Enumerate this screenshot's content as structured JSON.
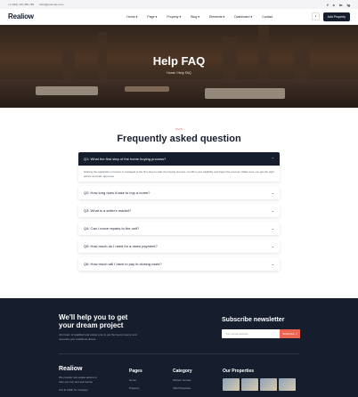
{
  "topbar": {
    "phone": "+1 (904) 123-456-789",
    "email": "hello@example.com",
    "socials": [
      "f",
      "x",
      "in",
      "ig"
    ]
  },
  "nav": {
    "logo": "Realiow",
    "menu": [
      "Home ▾",
      "Page ▾",
      "Property ▾",
      "Blog ▾",
      "Elements ▾",
      "Dashboard ▾",
      "Contact"
    ],
    "add_property": "Add Property"
  },
  "hero": {
    "title": "Help FAQ",
    "breadcrumb": "Home  /  Help FAQ"
  },
  "faq": {
    "tag": "FAQS",
    "heading": "Frequently asked question",
    "items": [
      {
        "q": "Q1: What the first step of the home buying process?",
        "open": true
      },
      {
        "q": "Q2: How long does it take to buy a home?"
      },
      {
        "q": "Q3: What is a seller's market?"
      },
      {
        "q": "Q4: Can I move repairs to the unit?"
      },
      {
        "q": "Q5: How much do I need for a down payment?"
      },
      {
        "q": "Q6: How much will I have to pay in closing costs?"
      }
    ],
    "answer": "Starting the application process is managed is the first step to start the buying process. Confirm your eligibility and begin the process. Make sure you get the right advice and loan approval."
  },
  "footer": {
    "heading": "We'll help you to get your dream project",
    "sub": "Join team of qualified real estate pros to get the best property and renovate your ambitious dream",
    "newsletter_title": "Subscribe newsletter",
    "newsletter_placeholder": "Your email address",
    "newsletter_button": "Subscribe ↗",
    "logo": "Realiow",
    "desc": "We provide real estate advice to help you buy and sell homes",
    "address": "101 E 129th St, Chicago",
    "pages_title": "Pages",
    "pages": [
      "Home",
      "Property"
    ],
    "category_title": "Category",
    "categories": [
      "Modern Homes",
      "Villa Properties"
    ],
    "props_title": "Our Properties"
  }
}
